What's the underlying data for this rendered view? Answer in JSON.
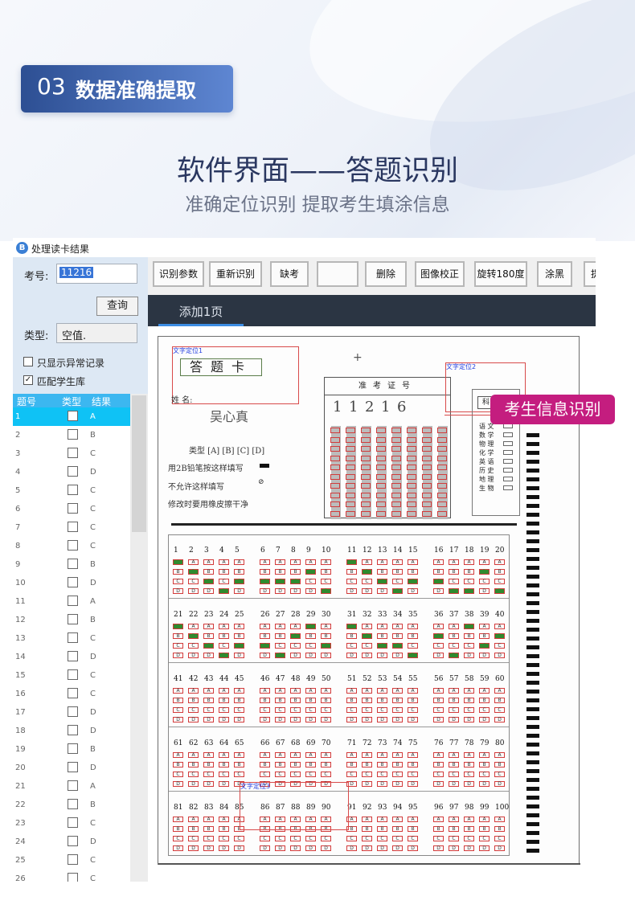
{
  "header": {
    "badge_number": "03",
    "badge_text": "数据准确提取",
    "title": "软件界面——答题识别",
    "subtitle": "准确定位识别  提取考生填涂信息"
  },
  "window": {
    "title": "处理读卡结果",
    "exam_no_label": "考号:",
    "exam_no_value": "11216",
    "query_button": "查询",
    "type_label": "类型:",
    "type_value": "空值.",
    "show_abnormal_label": "只显示异常记录",
    "show_abnormal_checked": false,
    "match_student_label": "匹配学生库",
    "match_student_checked": true,
    "table_headers": [
      "题号",
      "类型",
      "结果"
    ],
    "rows": [
      {
        "no": "1",
        "result": "A"
      },
      {
        "no": "2",
        "result": "B"
      },
      {
        "no": "3",
        "result": "C"
      },
      {
        "no": "4",
        "result": "D"
      },
      {
        "no": "5",
        "result": "C"
      },
      {
        "no": "6",
        "result": "C"
      },
      {
        "no": "7",
        "result": "C"
      },
      {
        "no": "8",
        "result": "C"
      },
      {
        "no": "9",
        "result": "B"
      },
      {
        "no": "10",
        "result": "D"
      },
      {
        "no": "11",
        "result": "A"
      },
      {
        "no": "12",
        "result": "B"
      },
      {
        "no": "13",
        "result": "C"
      },
      {
        "no": "14",
        "result": "D"
      },
      {
        "no": "15",
        "result": "C"
      },
      {
        "no": "16",
        "result": "C"
      },
      {
        "no": "17",
        "result": "D"
      },
      {
        "no": "18",
        "result": "D"
      },
      {
        "no": "19",
        "result": "B"
      },
      {
        "no": "20",
        "result": "D"
      },
      {
        "no": "21",
        "result": "A"
      },
      {
        "no": "22",
        "result": "B"
      },
      {
        "no": "23",
        "result": "C"
      },
      {
        "no": "24",
        "result": "D"
      },
      {
        "no": "25",
        "result": "C"
      },
      {
        "no": "26",
        "result": "C"
      }
    ],
    "toolbar": [
      "识别参数",
      "重新识别",
      "缺考",
      "",
      "删除",
      "图像校正",
      "旋转180度",
      "涂黑",
      "提"
    ],
    "tab_label": "添加1页"
  },
  "sheet": {
    "box1_label": "文字定位1",
    "box2_label": "文字定位2",
    "box3_label": "文字定位3",
    "card_title": "答题卡",
    "name_label": "姓  名:",
    "name_value": "吴心真",
    "exam_cert_title": "准考证号",
    "exam_digits": [
      "1",
      "1",
      "2",
      "1",
      "6"
    ],
    "type_line": "类型  [A] [B] [C] [D]",
    "instr1": "用2B铅笔按这样填写",
    "instr2": "不允许这样填写",
    "instr3": "修改时要用橡皮擦干净",
    "subject_code_title": "科目代号",
    "subjects": [
      "语  文",
      "数  学",
      "物  理",
      "化  学",
      "英  语",
      "历  史",
      "地  理",
      "生  物"
    ],
    "options": [
      "A",
      "B",
      "C",
      "D"
    ],
    "answers": [
      "A",
      "B",
      "C",
      "D",
      "C",
      "C",
      "C",
      "C",
      "B",
      "D",
      "A",
      "B",
      "C",
      "D",
      "C",
      "C",
      "D",
      "D",
      "B",
      "D",
      "A",
      "B",
      "C",
      "D",
      "C",
      "C",
      "D",
      "B",
      "A",
      "C",
      "A",
      "B",
      "C",
      "C",
      "D",
      "B",
      "D",
      "A",
      "C",
      "B"
    ]
  },
  "callout": "考生信息识别"
}
